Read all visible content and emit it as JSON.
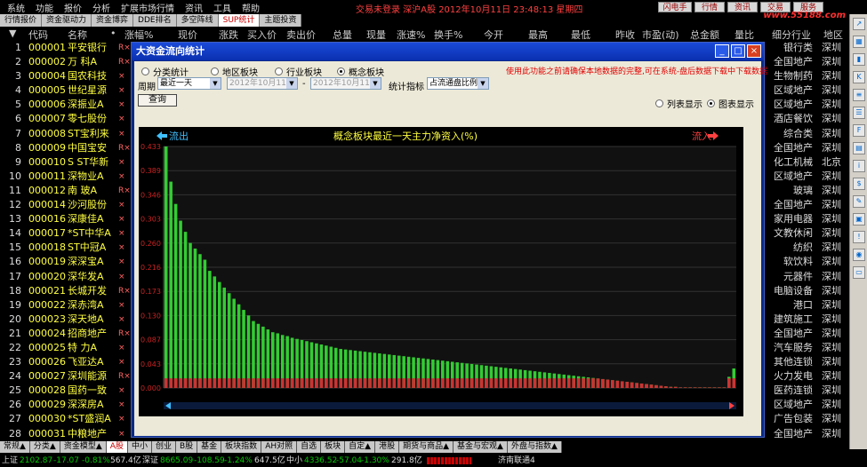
{
  "menu": [
    "系统",
    "功能",
    "报价",
    "分析",
    "扩展市场行情",
    "资讯",
    "工具",
    "帮助"
  ],
  "status_line": "交易未登录  深沪A股  2012年10月11日 23:48:13 星期四",
  "buttons": {
    "flash": "闪电手",
    "quote": "行情",
    "info": "资讯",
    "trade": "交易",
    "service": "服务"
  },
  "logo": "www.55188.com",
  "tabs": [
    {
      "label": "行情报价",
      "active": false
    },
    {
      "label": "资金驱动力",
      "active": false
    },
    {
      "label": "资金博弈",
      "active": false
    },
    {
      "label": "DDE排名",
      "active": false
    },
    {
      "label": "多空阵线",
      "active": false
    },
    {
      "label": "SUP统计",
      "active": true
    },
    {
      "label": "主题投资",
      "active": false
    }
  ],
  "columns": [
    "▼",
    "代码",
    "名称",
    "•",
    "涨幅%",
    "现价",
    "涨跌",
    "买入价",
    "卖出价",
    "总量",
    "现量",
    "涨速%",
    "换手%",
    "今开",
    "最高",
    "最低",
    "昨收",
    "市盈(动)",
    "总金额",
    "量比",
    "细分行业",
    "地区"
  ],
  "stocks": [
    {
      "i": "1",
      "code": "000001",
      "name": "平安银行",
      "tag": "R×",
      "industry": "银行类",
      "region": "深圳"
    },
    {
      "i": "2",
      "code": "000002",
      "name": "万  科A",
      "tag": "R×",
      "industry": "全国地产",
      "region": "深圳"
    },
    {
      "i": "3",
      "code": "000004",
      "name": "国农科技",
      "tag": "×",
      "industry": "生物制药",
      "region": "深圳"
    },
    {
      "i": "4",
      "code": "000005",
      "name": "世纪星源",
      "tag": "×",
      "industry": "区域地产",
      "region": "深圳"
    },
    {
      "i": "5",
      "code": "000006",
      "name": "深振业A",
      "tag": "×",
      "industry": "区域地产",
      "region": "深圳"
    },
    {
      "i": "6",
      "code": "000007",
      "name": "零七股份",
      "tag": "×",
      "industry": "酒店餐饮",
      "region": "深圳"
    },
    {
      "i": "7",
      "code": "000008",
      "name": "ST宝利来",
      "tag": "×",
      "industry": "综合类",
      "region": "深圳"
    },
    {
      "i": "8",
      "code": "000009",
      "name": "中国宝安",
      "tag": "R×",
      "industry": "全国地产",
      "region": "深圳"
    },
    {
      "i": "9",
      "code": "000010",
      "name": "S ST华新",
      "tag": "×",
      "industry": "化工机械",
      "region": "北京"
    },
    {
      "i": "10",
      "code": "000011",
      "name": "深物业A",
      "tag": "×",
      "industry": "区域地产",
      "region": "深圳"
    },
    {
      "i": "11",
      "code": "000012",
      "name": "南  玻A",
      "tag": "R×",
      "industry": "玻璃",
      "region": "深圳"
    },
    {
      "i": "12",
      "code": "000014",
      "name": "沙河股份",
      "tag": "×",
      "industry": "全国地产",
      "region": "深圳"
    },
    {
      "i": "13",
      "code": "000016",
      "name": "深康佳A",
      "tag": "×",
      "industry": "家用电器",
      "region": "深圳"
    },
    {
      "i": "14",
      "code": "000017",
      "name": "*ST中华A",
      "tag": "×",
      "industry": "文教休闲",
      "region": "深圳"
    },
    {
      "i": "15",
      "code": "000018",
      "name": "ST中冠A",
      "tag": "×",
      "industry": "纺织",
      "region": "深圳"
    },
    {
      "i": "16",
      "code": "000019",
      "name": "深深宝A",
      "tag": "×",
      "industry": "软饮料",
      "region": "深圳"
    },
    {
      "i": "17",
      "code": "000020",
      "name": "深华发A",
      "tag": "×",
      "industry": "元器件",
      "region": "深圳"
    },
    {
      "i": "18",
      "code": "000021",
      "name": "长城开发",
      "tag": "R×",
      "industry": "电脑设备",
      "region": "深圳"
    },
    {
      "i": "19",
      "code": "000022",
      "name": "深赤湾A",
      "tag": "×",
      "industry": "港口",
      "region": "深圳"
    },
    {
      "i": "20",
      "code": "000023",
      "name": "深天地A",
      "tag": "×",
      "industry": "建筑施工",
      "region": "深圳"
    },
    {
      "i": "21",
      "code": "000024",
      "name": "招商地产",
      "tag": "R×",
      "industry": "全国地产",
      "region": "深圳"
    },
    {
      "i": "22",
      "code": "000025",
      "name": "特  力A",
      "tag": "×",
      "industry": "汽车服务",
      "region": "深圳"
    },
    {
      "i": "23",
      "code": "000026",
      "name": "飞亚达A",
      "tag": "×",
      "industry": "其他连锁",
      "region": "深圳"
    },
    {
      "i": "24",
      "code": "000027",
      "name": "深圳能源",
      "tag": "R×",
      "industry": "火力发电",
      "region": "深圳"
    },
    {
      "i": "25",
      "code": "000028",
      "name": "国药一致",
      "tag": "×",
      "industry": "医药连锁",
      "region": "深圳"
    },
    {
      "i": "26",
      "code": "000029",
      "name": "深深房A",
      "tag": "×",
      "industry": "区域地产",
      "region": "深圳"
    },
    {
      "i": "27",
      "code": "000030",
      "name": "*ST盛润A",
      "tag": "×",
      "industry": "广告包装",
      "region": "深圳"
    },
    {
      "i": "28",
      "code": "000031",
      "name": "中粮地产",
      "tag": "×",
      "industry": "全国地产",
      "region": "深圳"
    }
  ],
  "bottom_tabs": [
    {
      "label": "常规▲",
      "active": false
    },
    {
      "label": "分类▲",
      "active": false
    },
    {
      "label": "资金模型▲",
      "active": false
    },
    {
      "label": "A股",
      "active": true
    },
    {
      "label": "中小",
      "active": false
    },
    {
      "label": "创业",
      "active": false
    },
    {
      "label": "B股",
      "active": false
    },
    {
      "label": "基金",
      "active": false
    },
    {
      "label": "板块指数",
      "active": false
    },
    {
      "label": "AH对照",
      "active": false
    },
    {
      "label": "自选",
      "active": false
    },
    {
      "label": "板块",
      "active": false
    },
    {
      "label": "自定▲",
      "active": false
    },
    {
      "label": "港股",
      "active": false
    },
    {
      "label": "期货与商品▲",
      "active": false
    },
    {
      "label": "基金与宏观▲",
      "active": false
    },
    {
      "label": "外盘与指数▲",
      "active": false
    }
  ],
  "ticker": {
    "sh_label": "上证",
    "sh_val": "2102.87",
    "sh_chg": "-17.07",
    "sh_pct": "-0.81%",
    "sh_amt": "567.4亿",
    "sz_label": "深证",
    "sz_val": "8665.09",
    "sz_chg": "-108.59",
    "sz_pct": "-1.24%",
    "sz_amt": "647.5亿",
    "zx_label": "中小",
    "zx_val": "4336.52",
    "zx_chg": "-57.04",
    "zx_pct": "-1.30%",
    "zx_amt": "291.8亿",
    "conn": "济南联通4"
  },
  "dialog": {
    "title": "大资金流向统计",
    "radios": [
      {
        "label": "分类统计",
        "on": false
      },
      {
        "label": "地区板块",
        "on": false
      },
      {
        "label": "行业板块",
        "on": false
      },
      {
        "label": "概念板块",
        "on": true
      }
    ],
    "note": "使用此功能之前请确保本地数据的完整,可在系统-盘后数据下载中下载数据",
    "period_label": "周期",
    "period_value": "最近一天",
    "date_from": "2012年10月11日",
    "date_sep": "-",
    "date_to": "2012年10月11日",
    "metric_label": "统计指标",
    "metric_value": "占流通盘比例",
    "query": "查询",
    "view_list": "列表显示",
    "view_chart": "图表显示",
    "view_list_on": false,
    "view_chart_on": true
  },
  "chart_data": {
    "type": "bar",
    "title": "概念板块最近一天主力净资入(%)",
    "left_label": "流出",
    "right_label": "流入",
    "ytick_labels": [
      "0.433",
      "0.389",
      "0.346",
      "0.303",
      "0.260",
      "0.216",
      "0.173",
      "0.130",
      "0.087",
      "0.043",
      "0.000"
    ],
    "ylim": [
      0,
      0.433
    ],
    "values": [
      0.433,
      0.37,
      0.33,
      0.3,
      0.28,
      0.26,
      0.25,
      0.24,
      0.23,
      0.21,
      0.2,
      0.19,
      0.18,
      0.17,
      0.16,
      0.15,
      0.14,
      0.13,
      0.12,
      0.115,
      0.11,
      0.105,
      0.1,
      0.098,
      0.095,
      0.093,
      0.09,
      0.088,
      0.086,
      0.084,
      0.082,
      0.08,
      0.078,
      0.076,
      0.074,
      0.072,
      0.07,
      0.069,
      0.068,
      0.067,
      0.066,
      0.065,
      0.064,
      0.063,
      0.062,
      0.061,
      0.06,
      0.059,
      0.058,
      0.057,
      0.056,
      0.055,
      0.054,
      0.053,
      0.052,
      0.051,
      0.05,
      0.049,
      0.048,
      0.047,
      0.046,
      0.045,
      0.044,
      0.043,
      0.042,
      0.041,
      0.04,
      0.039,
      0.038,
      0.037,
      0.036,
      0.035,
      0.034,
      0.033,
      0.032,
      0.031,
      0.03,
      0.029,
      0.028,
      0.027,
      0.026,
      0.025,
      0.024,
      0.023,
      0.022,
      0.021,
      0.02,
      0.019,
      0.018,
      0.017,
      0.016,
      0.015,
      0.014,
      0.013,
      0.012,
      0.011,
      0.01,
      0.009,
      0.008,
      0.007,
      0.006,
      0.005,
      0.004,
      0.003,
      0.002,
      0.002,
      0.001,
      0.001,
      0.001,
      0.001,
      0.001,
      0.001,
      0.001,
      0.001,
      0.001,
      0.001,
      0.02,
      0.035
    ],
    "colors": {
      "pos": "#33cc33",
      "neg": "#cc3333",
      "grid": "#333333",
      "axis": "#cc2222",
      "title": "#ffff40"
    }
  }
}
